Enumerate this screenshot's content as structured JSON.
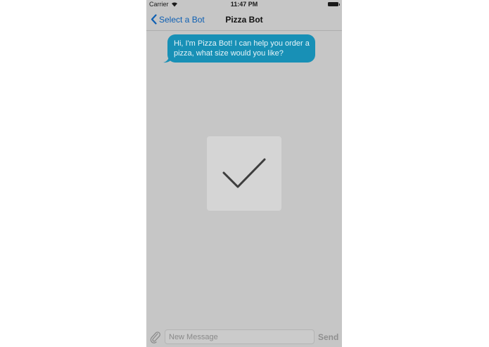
{
  "status_bar": {
    "carrier": "Carrier",
    "time": "11:47 PM"
  },
  "nav": {
    "back_label": "Select a Bot",
    "title": "Pizza Bot"
  },
  "messages": [
    {
      "sender": "bot",
      "text": "Hi, I'm Pizza Bot! I can help you order a pizza, what size would you like?"
    }
  ],
  "overlay": {
    "icon": "checkmark-icon",
    "state": "success"
  },
  "composer": {
    "attach_icon": "paperclip-icon",
    "placeholder": "New Message",
    "value": "",
    "send_label": "Send"
  },
  "colors": {
    "accent": "#0d5fb3",
    "bubble": "#1890b6",
    "background": "#c6c6c6"
  }
}
